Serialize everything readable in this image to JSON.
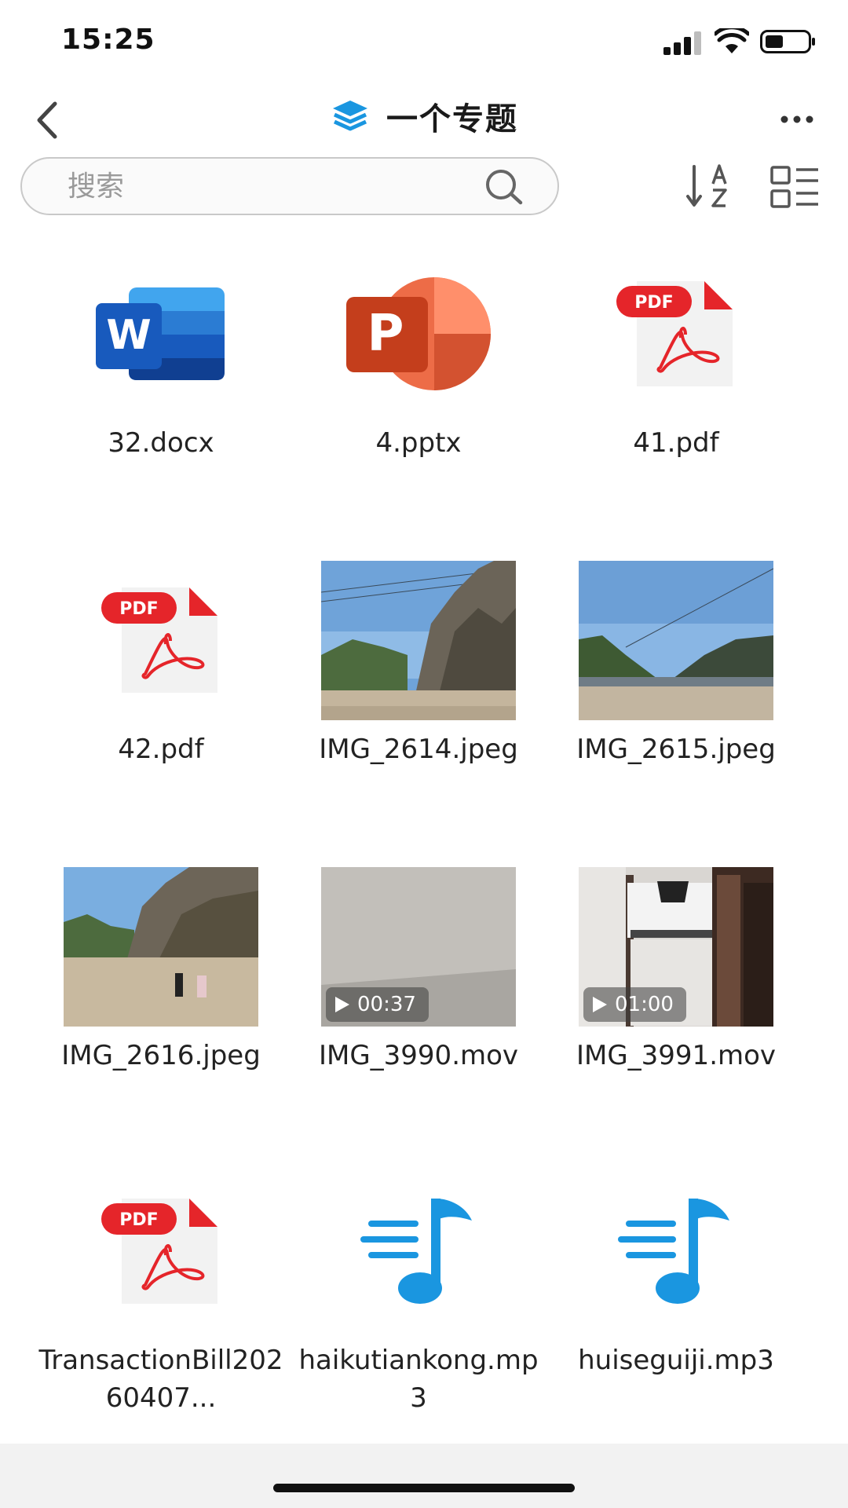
{
  "status_bar": {
    "time": "15:25",
    "icons": [
      "signal-icon",
      "wifi-icon",
      "battery-icon"
    ]
  },
  "nav": {
    "title": "一个专题",
    "title_icon": "layers-icon",
    "back_icon": "chevron-left-icon",
    "more_icon": "more-horizontal-icon",
    "accent_color": "#1a96e0"
  },
  "search": {
    "placeholder": "搜索",
    "value": ""
  },
  "toolbar": {
    "sort_icon": "sort-az-icon",
    "view_icon": "list-view-icon"
  },
  "files": [
    {
      "name": "32.docx",
      "type": "word"
    },
    {
      "name": "4.pptx",
      "type": "powerpoint"
    },
    {
      "name": "41.pdf",
      "type": "pdf"
    },
    {
      "name": "42.pdf",
      "type": "pdf"
    },
    {
      "name": "IMG_2614.jpeg",
      "type": "image"
    },
    {
      "name": "IMG_2615.jpeg",
      "type": "image"
    },
    {
      "name": "IMG_2616.jpeg",
      "type": "image"
    },
    {
      "name": "IMG_3990.mov",
      "type": "video",
      "duration": "00:37"
    },
    {
      "name": "IMG_3991.mov",
      "type": "video",
      "duration": "01:00"
    },
    {
      "name": "TransactionBill20260407...",
      "type": "pdf"
    },
    {
      "name": "haikutiankong.mp3",
      "type": "audio"
    },
    {
      "name": "huiseguiji.mp3",
      "type": "audio"
    }
  ],
  "pdf_badge": "PDF",
  "word_letter": "W",
  "ppt_letter": "P"
}
